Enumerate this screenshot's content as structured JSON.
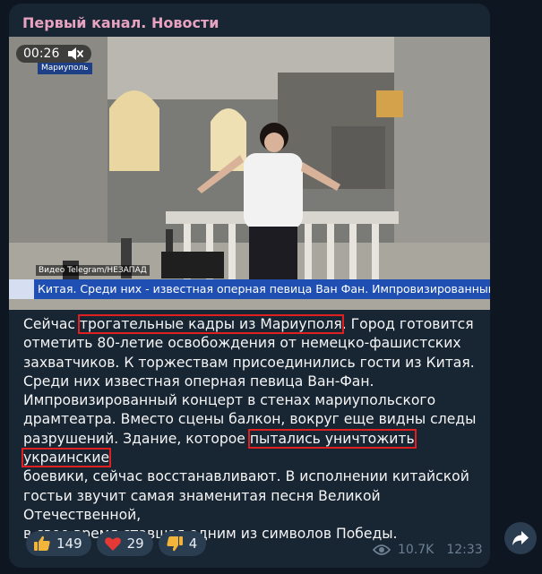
{
  "post": {
    "channel": "Первый канал. Новости",
    "video": {
      "duration": "00:26",
      "location_badge": "Мариуполь",
      "source_caption": "Видео Telegram/НЕЗАПАД",
      "ticker": "Китая.   Среди них - известная оперная певица Ван Фан.   Импровизированный ко"
    },
    "text": {
      "s1": "Сейчас ",
      "h1": "трогательные кадры из Мариуполя",
      "s2": ". Город готовится\nотметить 80-летие освобождения от немецко-фашистских\nзахватчиков. К торжествам присоединились гости из Китая.\nСреди них известная оперная певица Ван-Фан.\nИмпровизированный концерт в стенах мариупольского\nдрамтеатра. Вместо сцены балкон, вокруг еще видны следы\nразрушений. Здание, которое ",
      "h2": "пытались уничтожить украинские",
      "s3": "\nбоевики, сейчас восстанавливают. В исполнении китайской\nгостьи звучит самая знаменитая песня Великой Отечественной,\nв свое время ставшая одним из символов Победы."
    },
    "reactions": [
      {
        "icon": "thumbs-up-icon",
        "count": "149"
      },
      {
        "icon": "heart-icon",
        "count": "29"
      },
      {
        "icon": "thumbs-down-icon",
        "count": "4"
      }
    ],
    "views": "10.7K",
    "time": "12:33"
  },
  "colors": {
    "background": "#0e1621",
    "bubble": "#182533",
    "channel_name": "#e8a3c1",
    "highlight_box": "#e02020",
    "ticker": "#1f4fb2"
  }
}
